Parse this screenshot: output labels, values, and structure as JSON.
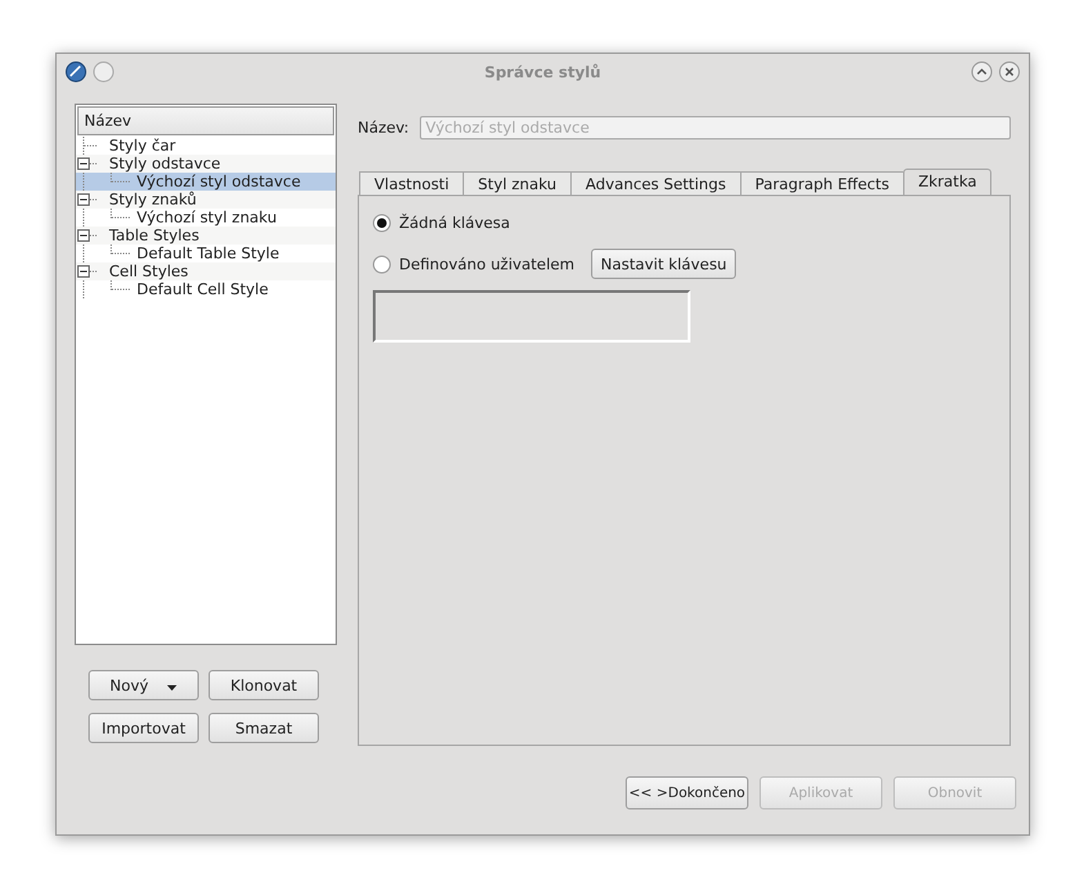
{
  "window": {
    "title": "Správce stylů"
  },
  "tree": {
    "header": "Název",
    "items": [
      {
        "label": "Styly čar",
        "selected": false
      },
      {
        "label": "Styly odstavce",
        "expanded": true,
        "selected": false,
        "children": [
          {
            "label": "Výchozí styl odstavce",
            "selected": true
          }
        ]
      },
      {
        "label": "Styly znaků",
        "expanded": true,
        "selected": false,
        "children": [
          {
            "label": "Výchozí styl znaku",
            "selected": false
          }
        ]
      },
      {
        "label": "Table Styles",
        "expanded": true,
        "selected": false,
        "children": [
          {
            "label": "Default Table Style",
            "selected": false
          }
        ]
      },
      {
        "label": "Cell Styles",
        "expanded": true,
        "selected": false,
        "children": [
          {
            "label": "Default Cell Style",
            "selected": false
          }
        ]
      }
    ]
  },
  "left_buttons": [
    {
      "label": "Nový",
      "kind": "dropdown"
    },
    {
      "label": "Klonovat",
      "kind": "plain"
    },
    {
      "label": "Importovat",
      "kind": "plain"
    },
    {
      "label": "Smazat",
      "kind": "plain"
    }
  ],
  "name_field": {
    "label": "Název:",
    "placeholder": "Výchozí styl odstavce"
  },
  "tabs": [
    {
      "label": "Vlastnosti",
      "selected": false
    },
    {
      "label": "Styl znaku",
      "selected": false
    },
    {
      "label": "Advances Settings",
      "selected": false
    },
    {
      "label": "Paragraph Effects",
      "selected": false
    },
    {
      "label": "Zkratka",
      "selected": true
    }
  ],
  "shortcut": {
    "options": [
      {
        "label": "Žádná klávesa",
        "selected": true
      },
      {
        "label": "Definováno uživatelem",
        "selected": false
      }
    ],
    "set_button": "Nastavit klávesu"
  },
  "bottom_buttons": [
    {
      "label": "<< >Dokončeno",
      "disabled": false
    },
    {
      "label": "Aplikovat",
      "disabled": true
    },
    {
      "label": "Obnovit",
      "disabled": true
    }
  ]
}
